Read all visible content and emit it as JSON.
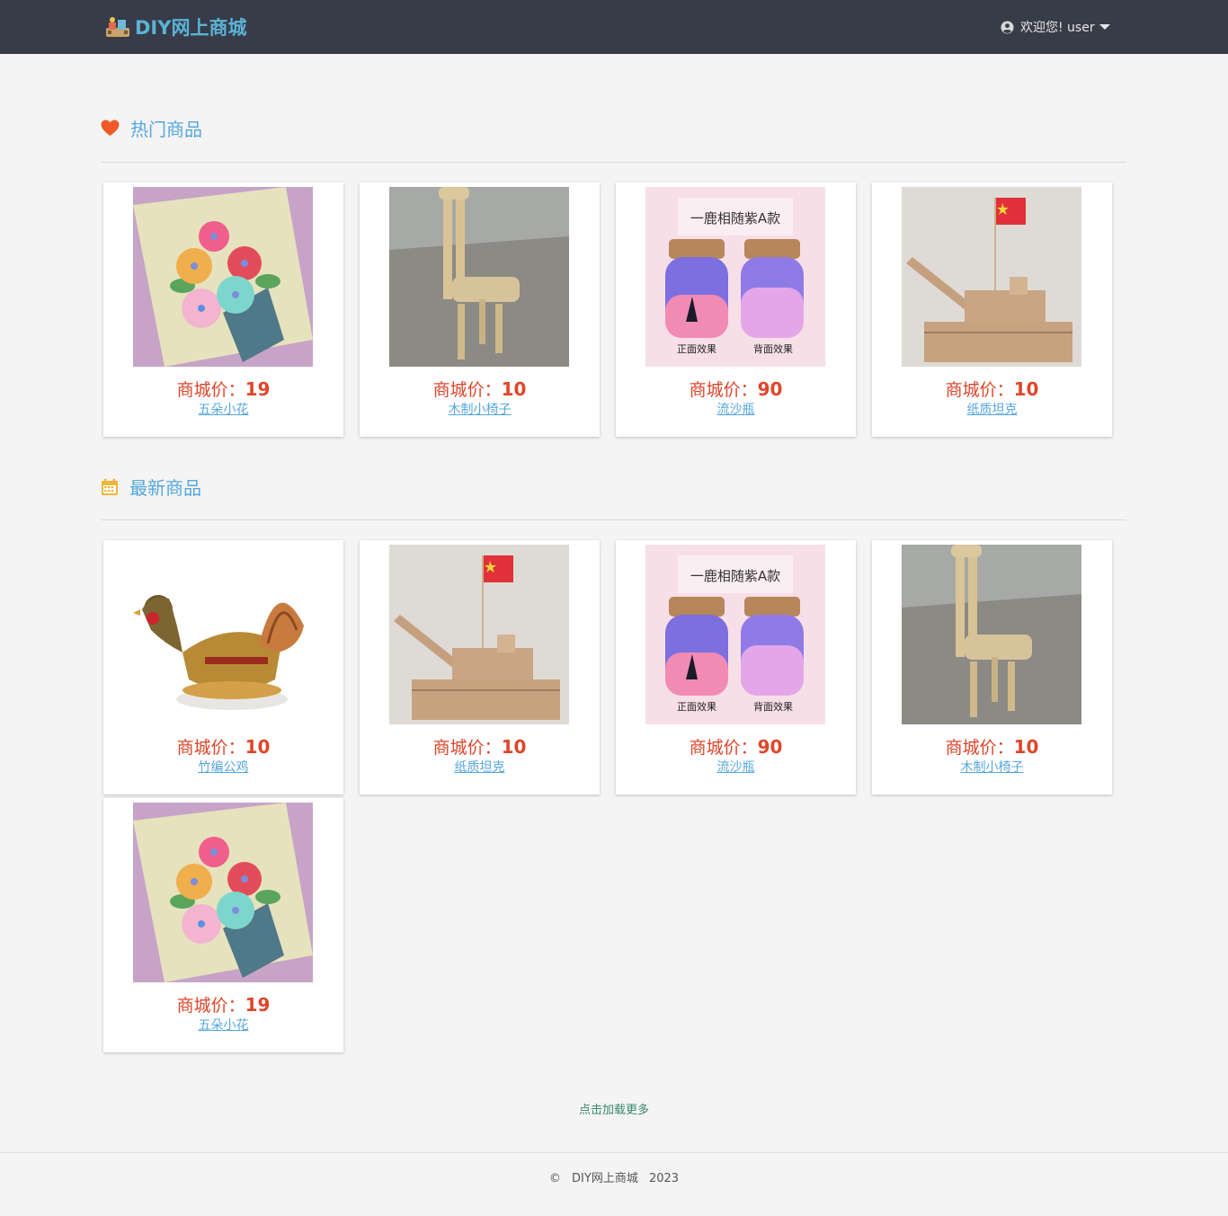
{
  "navbar": {
    "brand": "DIY网上商城",
    "user_greeting": "欢迎您! user"
  },
  "hot_section": {
    "title": "热门商品",
    "icon": "heart-icon",
    "icon_color": "#f05a28"
  },
  "new_section": {
    "title": "最新商品",
    "icon": "calendar-icon",
    "icon_color": "#f0b63c"
  },
  "price_prefix": "商城价：",
  "hot_products": [
    {
      "price": "19",
      "name": "五朵小花",
      "image": "paper-flowers"
    },
    {
      "price": "10",
      "name": "木制小椅子",
      "image": "wooden-chair"
    },
    {
      "price": "90",
      "name": "流沙瓶",
      "image": "sand-bottles"
    },
    {
      "price": "10",
      "name": "纸质坦克",
      "image": "paper-tank"
    }
  ],
  "new_products": [
    {
      "price": "10",
      "name": "竹编公鸡",
      "image": "bamboo-rooster"
    },
    {
      "price": "10",
      "name": "纸质坦克",
      "image": "paper-tank"
    },
    {
      "price": "90",
      "name": "流沙瓶",
      "image": "sand-bottles"
    },
    {
      "price": "10",
      "name": "木制小椅子",
      "image": "wooden-chair"
    },
    {
      "price": "19",
      "name": "五朵小花",
      "image": "paper-flowers"
    }
  ],
  "sand_label": {
    "top": "一鹿相随紫A款",
    "left": "正面效果",
    "right": "背面效果"
  },
  "load_more": "点击加载更多",
  "footer": {
    "copyright": "©",
    "site": "DIY网上商城",
    "year": "2023"
  },
  "colors": {
    "navbar_bg": "#373c48",
    "accent_blue": "#55a7de",
    "price_red": "#e0452a"
  }
}
